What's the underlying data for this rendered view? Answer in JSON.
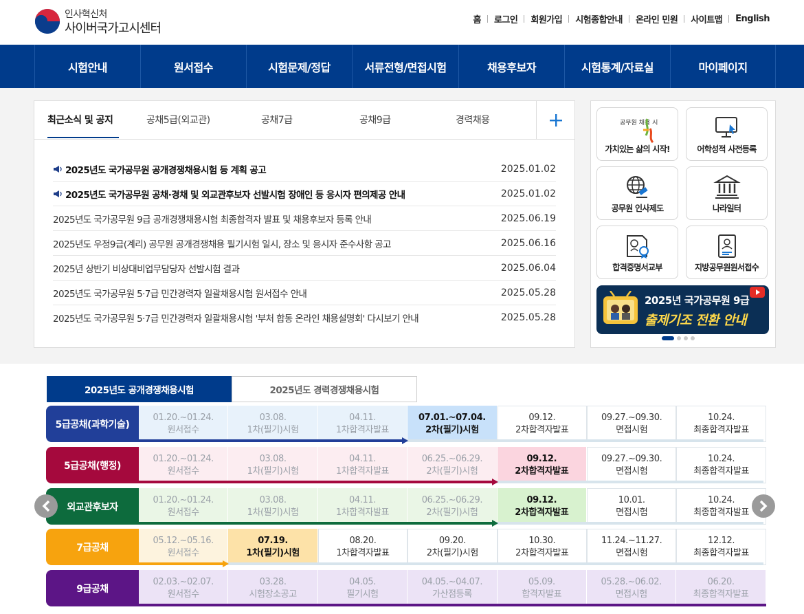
{
  "header": {
    "org_name": "인사혁신처",
    "site_name": "사이버국가고시센터",
    "util_links": [
      "홈",
      "로그인",
      "회원가입",
      "시험종합안내",
      "온라인 민원",
      "사이트맵",
      "English"
    ]
  },
  "gnb": [
    "시험안내",
    "원서접수",
    "시험문제/정답",
    "서류전형/면접시험",
    "채용후보자",
    "시험통계/자료실",
    "마이페이지"
  ],
  "news": {
    "tabs": [
      "최근소식 및 공지",
      "공채5급(외교관)",
      "공채7급",
      "공채9급",
      "경력채용"
    ],
    "more_label": "+",
    "items": [
      {
        "title": "2025년도 국가공무원 공개경쟁채용시험 등 계획 공고",
        "date": "2025.01.02",
        "notice": true
      },
      {
        "title": "2025년도 국가공무원 공채·경채 및 외교관후보자 선발시험 장애인 등 응시자 편의제공 안내",
        "date": "2025.01.02",
        "notice": true
      },
      {
        "title": "2025년도 국가공무원 9급 공개경쟁채용시험 최종합격자 발표 및 채용후보자 등록 안내",
        "date": "2025.06.19",
        "notice": false
      },
      {
        "title": "2025년도 우정9급(계리) 공무원 공개경쟁채용 필기시험 일시, 장소 및 응시자 준수사항 공고",
        "date": "2025.06.16",
        "notice": false
      },
      {
        "title": "2025년 상반기 비상대비업무담당자 선발시험 결과",
        "date": "2025.06.04",
        "notice": false
      },
      {
        "title": "2025년도 국가공무원 5·7급 민간경력자 일괄채용시험 원서접수 안내",
        "date": "2025.05.28",
        "notice": false
      },
      {
        "title": "2025년도 국가공무원 5·7급 민간경력자 일괄채용시험 '부처 합동 온라인 채용설명회' 다시보기 안내",
        "date": "2025.05.28",
        "notice": false
      }
    ]
  },
  "quick": {
    "buttons": [
      {
        "label": "가치있는 삶의 시작!",
        "icon": "recruit-logo-icon",
        "logo_text": "공무원 채용 시험"
      },
      {
        "label": "어학성적 사전등록",
        "icon": "monitor-cursor-icon"
      },
      {
        "label": "공무원 인사제도",
        "icon": "globe-gavel-icon"
      },
      {
        "label": "나라일터",
        "icon": "government-building-icon"
      },
      {
        "label": "합격증명서교부",
        "icon": "certificate-icon"
      },
      {
        "label": "지방공무원원서접수",
        "icon": "person-document-icon"
      }
    ],
    "banner": {
      "line1": "2025년 국가공무원 9급",
      "line2": "출제기조 전환 안내"
    },
    "slide_count": 4,
    "slide_active": 1
  },
  "schedule": {
    "tabs": [
      "2025년도 공개경쟁채용시험",
      "2025년도 경력경쟁채용시험"
    ],
    "rows": [
      {
        "label": "5급공채(과학기술)",
        "color": "#213f99",
        "current": 3,
        "highlight": "#c8e1fa",
        "past_bg": "#e8f2fb",
        "cells": [
          [
            "01.20.~01.24.",
            "원서접수"
          ],
          [
            "03.08.",
            "1차(필기)시험"
          ],
          [
            "04.11.",
            "1차합격자발표"
          ],
          [
            "07.01.~07.04.",
            "2차(필기)시험"
          ],
          [
            "09.12.",
            "2차합격자발표"
          ],
          [
            "09.27.~09.30.",
            "면접시험"
          ],
          [
            "10.24.",
            "최종합격자발표"
          ]
        ]
      },
      {
        "label": "5급공채(행정)",
        "color": "#a5093d",
        "current": 4,
        "highlight": "#fbd5df",
        "past_bg": "#fcedf1",
        "cells": [
          [
            "01.20.~01.24.",
            "원서접수"
          ],
          [
            "03.08.",
            "1차(필기)시험"
          ],
          [
            "04.11.",
            "1차합격자발표"
          ],
          [
            "06.25.~06.29.",
            "2차(필기)시험"
          ],
          [
            "09.12.",
            "2차합격자발표"
          ],
          [
            "09.27.~09.30.",
            "면접시험"
          ],
          [
            "10.24.",
            "최종합격자발표"
          ]
        ]
      },
      {
        "label": "외교관후보자",
        "color": "#0d6b3d",
        "current": 4,
        "highlight": "#d8f2cf",
        "past_bg": "#eaf6e6",
        "cells": [
          [
            "01.20.~01.24.",
            "원서접수"
          ],
          [
            "03.08.",
            "1차(필기)시험"
          ],
          [
            "04.11.",
            "1차합격자발표"
          ],
          [
            "06.25.~06.29.",
            "2차(필기)시험"
          ],
          [
            "09.12.",
            "2차합격자발표"
          ],
          [
            "10.01.",
            "면접시험"
          ],
          [
            "10.24.",
            "최종합격자발표"
          ]
        ]
      },
      {
        "label": "7급공채",
        "color": "#f7a30e",
        "current": 1,
        "highlight": "#fde2a8",
        "past_bg": "#fdf3de",
        "cells": [
          [
            "05.12.~05.16.",
            "원서접수"
          ],
          [
            "07.19.",
            "1차(필기)시험"
          ],
          [
            "08.20.",
            "1차합격자발표"
          ],
          [
            "09.20.",
            "2차(필기)시험"
          ],
          [
            "10.30.",
            "2차합격자발표"
          ],
          [
            "11.24.~11.27.",
            "면접시험"
          ],
          [
            "12.12.",
            "최종합격자발표"
          ]
        ]
      },
      {
        "label": "9급공채",
        "color": "#5c1586",
        "current": 7,
        "highlight": "#ece3f6",
        "past_bg": "#f0e9f7",
        "cells": [
          [
            "02.03.~02.07.",
            "원서접수"
          ],
          [
            "03.28.",
            "시험장소공고"
          ],
          [
            "04.05.",
            "필기시험"
          ],
          [
            "04.05.~04.07.",
            "가산점등록"
          ],
          [
            "05.09.",
            "합격자발표"
          ],
          [
            "05.28.~06.02.",
            "면접시험"
          ],
          [
            "06.20.",
            "최종합격자발표"
          ]
        ]
      }
    ],
    "prev_label": "‹",
    "next_label": "›"
  }
}
